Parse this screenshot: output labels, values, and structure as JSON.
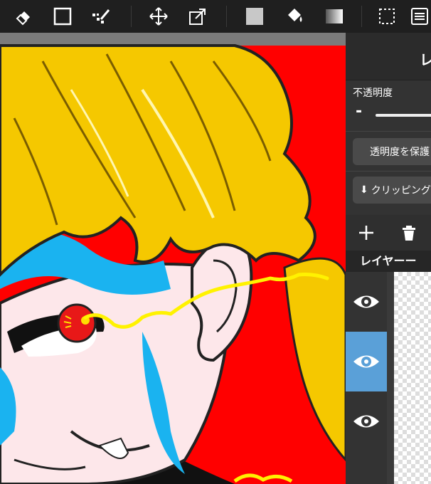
{
  "toolbar": {
    "tools": [
      "eraser-icon",
      "rectangle-select-icon",
      "magic-wand-icon",
      "move-icon",
      "transform-icon",
      "fill-color-icon",
      "bucket-icon",
      "gradient-icon",
      "lasso-select-icon",
      "menu-icon"
    ]
  },
  "panel": {
    "header_text": "レ",
    "opacity_label": "不透明度",
    "slider_minus": "-",
    "protect_alpha_label": "透明度を保護",
    "clipping_label": "クリッピング",
    "clipping_arrow": "⬇",
    "layer_title": "レイヤーー",
    "layers": [
      {
        "visible": true,
        "selected": false
      },
      {
        "visible": true,
        "selected": true
      },
      {
        "visible": true,
        "selected": false
      }
    ]
  },
  "colors": {
    "toolbar_bg": "#1f1f1f",
    "panel_bg": "#333333",
    "selected_layer": "#5aa0d8",
    "hair": "#f5c800",
    "background_red": "#ff0000",
    "skin": "#fde7ea",
    "shadow_blue": "#1ab3f0"
  }
}
